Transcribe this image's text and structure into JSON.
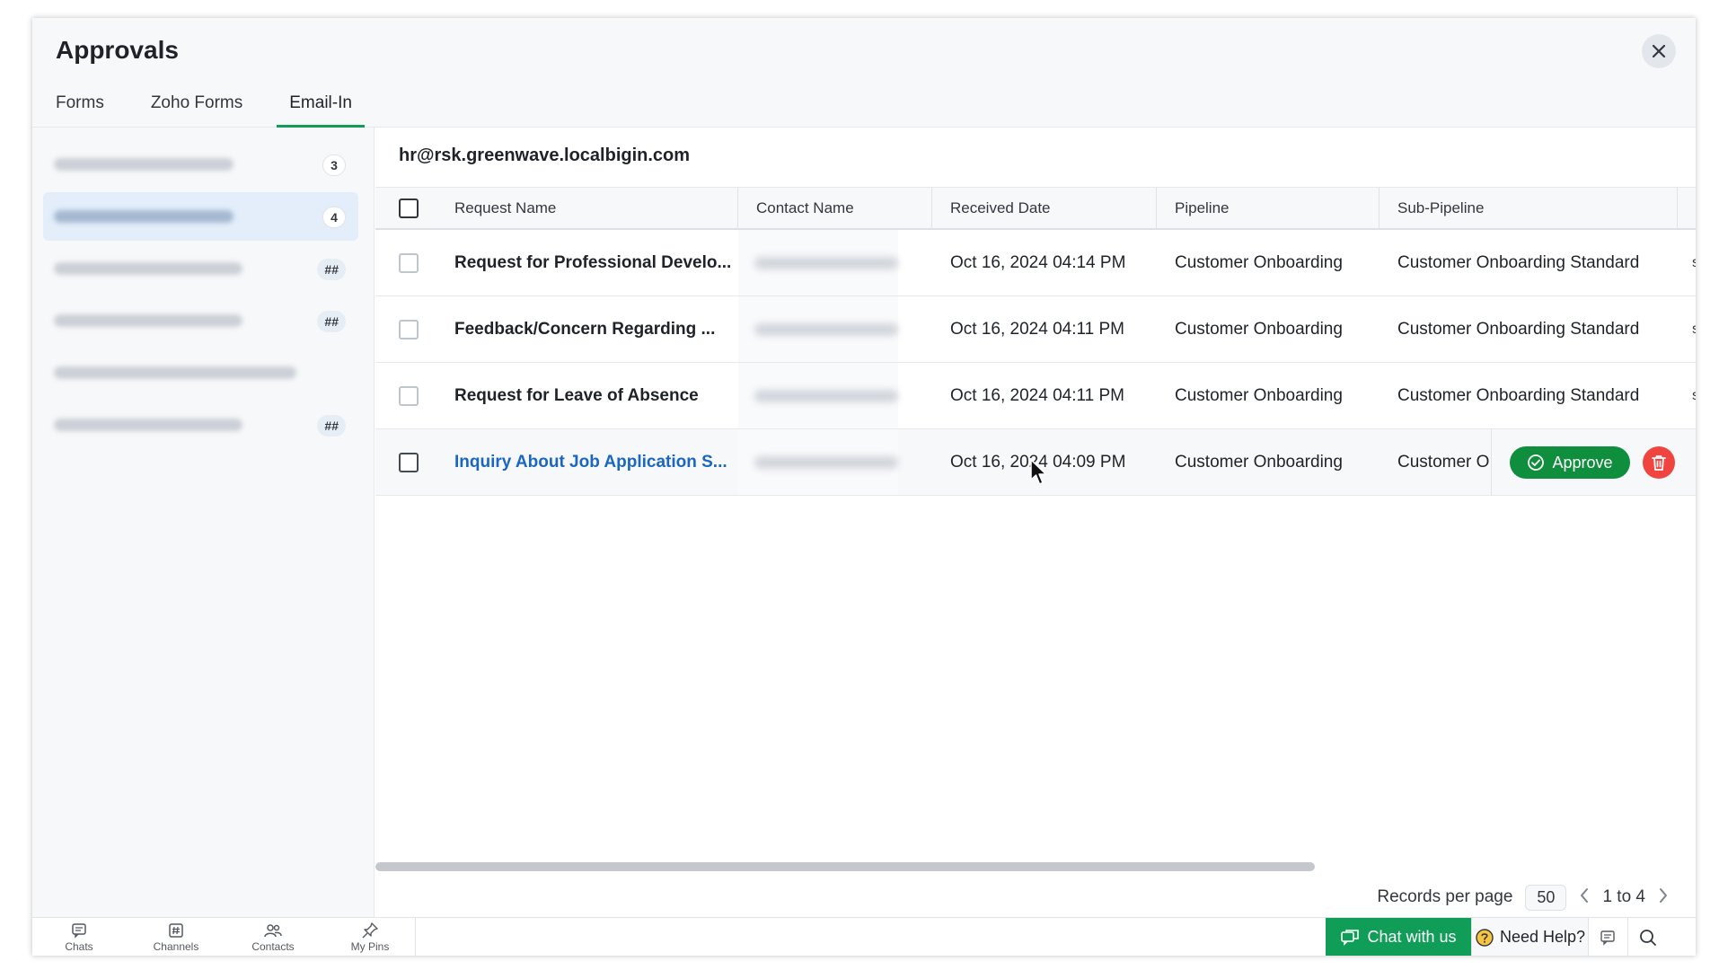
{
  "header": {
    "title": "Approvals"
  },
  "tabs": [
    {
      "label": "Forms"
    },
    {
      "label": "Zoho Forms"
    },
    {
      "label": "Email-In"
    }
  ],
  "sidebar": {
    "items": [
      {
        "badge": "3"
      },
      {
        "badge": "4"
      },
      {
        "badge": "##"
      },
      {
        "badge": "##"
      },
      {
        "badge": ""
      },
      {
        "badge": "##"
      }
    ]
  },
  "main": {
    "email_title": "hr@rsk.greenwave.localbigin.com",
    "columns": [
      "Request Name",
      "Contact Name",
      "Received Date",
      "Pipeline",
      "Sub-Pipeline"
    ],
    "rows": [
      {
        "name": "Request for Professional Develo...",
        "date": "Oct 16, 2024 04:14 PM",
        "pipeline": "Customer Onboarding",
        "sub_pipeline": "Customer Onboarding Standard",
        "extra": "s"
      },
      {
        "name": "Feedback/Concern Regarding ...",
        "date": "Oct 16, 2024 04:11 PM",
        "pipeline": "Customer Onboarding",
        "sub_pipeline": "Customer Onboarding Standard",
        "extra": "s"
      },
      {
        "name": "Request for Leave of Absence",
        "date": "Oct 16, 2024 04:11 PM",
        "pipeline": "Customer Onboarding",
        "sub_pipeline": "Customer Onboarding Standard",
        "extra": "s"
      },
      {
        "name": "Inquiry About Job Application S...",
        "date": "Oct 16, 2024 04:09 PM",
        "pipeline": "Customer Onboarding",
        "sub_pipeline": "Customer O"
      }
    ],
    "approve_label": "Approve"
  },
  "pager": {
    "records_label": "Records per page",
    "per_page": "50",
    "range": "1 to 4"
  },
  "bottombar": {
    "items": [
      "Chats",
      "Channels",
      "Contacts",
      "My Pins"
    ],
    "chat_label": "Chat with us",
    "help_label": "Need Help?"
  },
  "colors": {
    "accent": "#0f9d58",
    "link": "#1a66c0",
    "approve": "#0f8f3e",
    "delete": "#f0443f"
  }
}
